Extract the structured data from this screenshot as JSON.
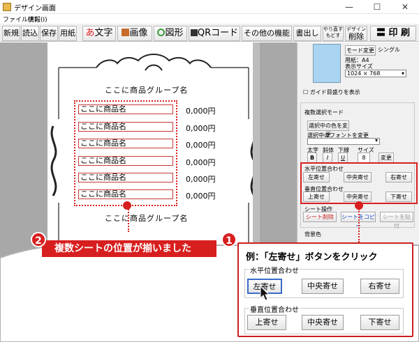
{
  "window": {
    "title": "デザイン画面",
    "minimize": "—",
    "maximize": "☐",
    "close": "✕"
  },
  "menu": {
    "file": "ファイル(F)",
    "settings": "情報(I)"
  },
  "toolbar": {
    "new": "新規",
    "open": "読込",
    "save": "保存",
    "paper": "用紙",
    "text_icon": "あ",
    "text": "文字",
    "image": "画像",
    "shape": "図形",
    "qr": "QRコード",
    "other": "その他の機能",
    "write": "書出し",
    "redo": "やり直す",
    "undo": "もどす",
    "design": "デザイン",
    "delete": "削除",
    "print": "印 刷"
  },
  "sheet": {
    "group_title_top": "ここに商品グループ名",
    "group_title_bottom": "ここに商品グループ名",
    "items": [
      {
        "name": "ここに商品名",
        "price": "0,000円"
      },
      {
        "name": "ここに商品名",
        "price": "0,000円"
      },
      {
        "name": "ここに商品名",
        "price": "0,000円"
      },
      {
        "name": "ここに商品名",
        "price": "0,000円"
      },
      {
        "name": "ここに商品名",
        "price": "0,000円"
      },
      {
        "name": "ここに商品名",
        "price": "0,000円"
      }
    ]
  },
  "panel": {
    "mode_button": "モード変更",
    "mode_value": "シングル",
    "paper_label": "用紙：A4",
    "display_size_label": "表示サイズ",
    "display_size_value": "1024 × 768",
    "guide_checkbox": "ガイド目盛りを表示",
    "multi_select_label": "複数選択モード",
    "change_color": "選択中の色を変更",
    "change_font": "選択中のフォントを変更",
    "bold": "太字",
    "italic": "斜体",
    "underline": "下線",
    "size": "サイズ",
    "bold_btn": "B",
    "italic_btn": "I",
    "underline_btn": "U",
    "size_value": "8",
    "apply": "変更",
    "horizontal_label": "水平位置合わせ",
    "left": "左寄せ",
    "center": "中央寄せ",
    "right": "右寄せ",
    "vertical_label": "垂直位置合わせ",
    "top": "上寄せ",
    "middle": "中央寄せ",
    "bottom": "下寄せ",
    "sheet_ops_label": "シート操作",
    "sheet_delete": "シート削除",
    "sheet_copy": "シートをコピー",
    "sheet_paste": "シートを貼付",
    "background_label": "背景色"
  },
  "callouts": {
    "step1_num": "1",
    "step1_text": "例：「左寄せ」ボタンをクリック",
    "step2_num": "2",
    "step2_text": "複数シートの位置が揃いました"
  },
  "zoom": {
    "horizontal_label": "水平位置合わせ",
    "left": "左寄せ",
    "center": "中央寄せ",
    "right": "右寄せ",
    "vertical_label": "垂直位置合わせ",
    "top": "上寄せ",
    "middle": "中央寄せ",
    "bottom": "下寄せ"
  },
  "colors": {
    "accent_red": "#d81f1f",
    "preview_blue": "#a9d4f2"
  }
}
